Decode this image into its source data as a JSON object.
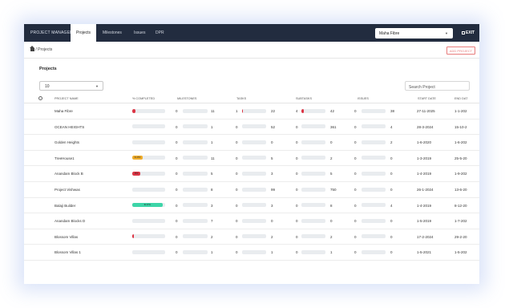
{
  "topbar": {
    "brand": "PROJECT MANAGER",
    "tabs": [
      "Projects",
      "Milestones",
      "Issues",
      "DPR"
    ],
    "selected_project": "Maha Fibre",
    "exit_label": "EXIT"
  },
  "breadcrumb": "/ Projects",
  "add_project_label": "ADD PROJECT",
  "section_title": "Projects",
  "page_size": "10",
  "search_placeholder": "Search Project",
  "columns": [
    "PROJECT NAME",
    "% COMPLETED",
    "MILESTONES",
    "TASKS",
    "SUBTASKS",
    "ISSUES",
    "START DATE",
    "END DAT"
  ],
  "colors": {
    "red": "#dc3545",
    "yellow": "#f0ad2b",
    "green": "#3dd5a8",
    "topbar": "#222c3f"
  },
  "rows": [
    {
      "name": "Maha Fibre",
      "pct": 10,
      "pct_label": "",
      "pct_color": "red",
      "ms_done": "0",
      "ms_total": "11",
      "ms_pct": 0,
      "t_done": "1",
      "t_total": "22",
      "t_pct": 4.5,
      "st_done": "4",
      "st_total": "42",
      "st_pct": 9.5,
      "is_done": "0",
      "is_total": "38",
      "is_pct": 0,
      "start": "27-11-2025",
      "end": "1-1-202"
    },
    {
      "name": "OCEAN HEIGHTS",
      "pct": 0,
      "pct_label": "",
      "pct_color": "red",
      "ms_done": "0",
      "ms_total": "1",
      "ms_pct": 0,
      "t_done": "0",
      "t_total": "52",
      "t_pct": 0,
      "st_done": "0",
      "st_total": "361",
      "st_pct": 0,
      "is_done": "0",
      "is_total": "4",
      "is_pct": 0,
      "start": "28-3-2024",
      "end": "15-10-2"
    },
    {
      "name": "Golden Heights",
      "pct": 0,
      "pct_label": "",
      "pct_color": "red",
      "ms_done": "0",
      "ms_total": "1",
      "ms_pct": 0,
      "t_done": "0",
      "t_total": "0",
      "t_pct": 0,
      "st_done": "0",
      "st_total": "0",
      "st_pct": 0,
      "is_done": "0",
      "is_total": "2",
      "is_pct": 0,
      "start": "1-6-2020",
      "end": "1-6-202"
    },
    {
      "name": "TreeHouse1",
      "pct": 31.25,
      "pct_label": "31.25%",
      "pct_color": "yellow",
      "ms_done": "0",
      "ms_total": "11",
      "ms_pct": 0,
      "t_done": "0",
      "t_total": "5",
      "t_pct": 0,
      "st_done": "0",
      "st_total": "2",
      "st_pct": 0,
      "is_done": "0",
      "is_total": "0",
      "is_pct": 0,
      "start": "1-3-2019",
      "end": "25-5-20"
    },
    {
      "name": "Anandam Block B",
      "pct": 25,
      "pct_label": "25%",
      "pct_color": "red",
      "ms_done": "0",
      "ms_total": "5",
      "ms_pct": 0,
      "t_done": "0",
      "t_total": "3",
      "t_pct": 0,
      "st_done": "0",
      "st_total": "5",
      "st_pct": 0,
      "is_done": "0",
      "is_total": "0",
      "is_pct": 0,
      "start": "1-4-2019",
      "end": "1-9-202"
    },
    {
      "name": "Project Vishwas",
      "pct": 0,
      "pct_label": "",
      "pct_color": "red",
      "ms_done": "0",
      "ms_total": "8",
      "ms_pct": 0,
      "t_done": "0",
      "t_total": "99",
      "t_pct": 0,
      "st_done": "0",
      "st_total": "750",
      "st_pct": 0,
      "is_done": "0",
      "is_total": "0",
      "is_pct": 0,
      "start": "26-1-2024",
      "end": "13-6-20"
    },
    {
      "name": "Balaji Builder",
      "pct": 91.67,
      "pct_label": "91.67%",
      "pct_color": "green",
      "ms_done": "0",
      "ms_total": "3",
      "ms_pct": 0,
      "t_done": "0",
      "t_total": "3",
      "t_pct": 0,
      "st_done": "0",
      "st_total": "8",
      "st_pct": 0,
      "is_done": "0",
      "is_total": "4",
      "is_pct": 0,
      "start": "1-4-2019",
      "end": "8-12-20"
    },
    {
      "name": "Anandam Blocks D",
      "pct": 0,
      "pct_label": "",
      "pct_color": "red",
      "ms_done": "0",
      "ms_total": "7",
      "ms_pct": 0,
      "t_done": "0",
      "t_total": "0",
      "t_pct": 0,
      "st_done": "0",
      "st_total": "0",
      "st_pct": 0,
      "is_done": "0",
      "is_total": "0",
      "is_pct": 0,
      "start": "1-5-2019",
      "end": "1-7-202"
    },
    {
      "name": "Blossom Villas",
      "pct": 5,
      "pct_label": "",
      "pct_color": "red",
      "ms_done": "0",
      "ms_total": "2",
      "ms_pct": 0,
      "t_done": "0",
      "t_total": "2",
      "t_pct": 0,
      "st_done": "0",
      "st_total": "2",
      "st_pct": 0,
      "is_done": "0",
      "is_total": "0",
      "is_pct": 0,
      "start": "17-2-2024",
      "end": "29-2-20"
    },
    {
      "name": "Blossom Villas 1",
      "pct": 0,
      "pct_label": "",
      "pct_color": "red",
      "ms_done": "0",
      "ms_total": "1",
      "ms_pct": 0,
      "t_done": "0",
      "t_total": "1",
      "t_pct": 0,
      "st_done": "0",
      "st_total": "1",
      "st_pct": 0,
      "is_done": "0",
      "is_total": "0",
      "is_pct": 0,
      "start": "1-5-2021",
      "end": "1-5-202"
    }
  ]
}
